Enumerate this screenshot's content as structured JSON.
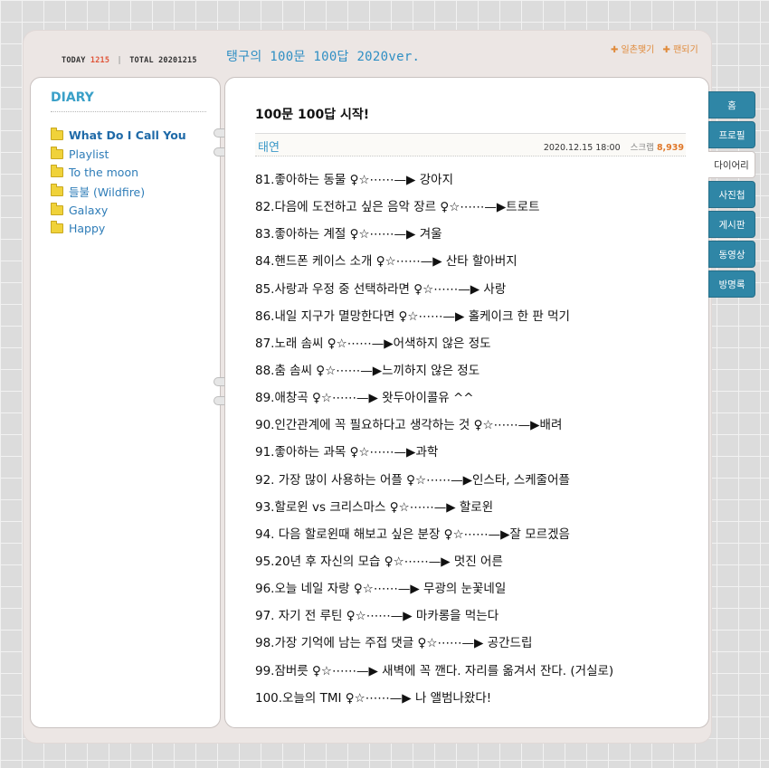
{
  "header": {
    "today_label": "TODAY",
    "today_count": "1215",
    "separator": "|",
    "total_label": "TOTAL",
    "total_count": "20201215",
    "title": "탱구의 100문 100답 2020ver.",
    "link_wave": "✚ 일촌맺기",
    "link_surf": "✚ 팬되기"
  },
  "sidebar": {
    "heading": "DIARY",
    "folders": [
      {
        "label": "What Do I Call You"
      },
      {
        "label": "Playlist"
      },
      {
        "label": "To the moon"
      },
      {
        "label": "들불 (Wildfire)"
      },
      {
        "label": "Galaxy"
      },
      {
        "label": "Happy"
      }
    ]
  },
  "post": {
    "title": "100문 100답 시작!",
    "author": "태연",
    "date": "2020.12.15 18:00",
    "scrap_label": "스크랩",
    "scrap_count": "8,939",
    "lines": [
      "81.좋아하는 동물 ♀☆⋯⋯—▶ 강아지",
      "82.다음에 도전하고 싶은 음악 장르 ♀☆⋯⋯—▶트로트",
      "83.좋아하는 계절 ♀☆⋯⋯—▶ 겨울",
      "84.핸드폰 케이스 소개 ♀☆⋯⋯—▶ 산타 할아버지",
      "85.사랑과 우정 중 선택하라면 ♀☆⋯⋯—▶ 사랑",
      "86.내일 지구가 멸망한다면 ♀☆⋯⋯—▶ 홀케이크 한 판 먹기",
      "87.노래 솜씨 ♀☆⋯⋯—▶어색하지 않은 정도",
      "88.춤 솜씨 ♀☆⋯⋯—▶느끼하지 않은 정도",
      "89.애창곡 ♀☆⋯⋯—▶ 왓두아이콜유 ^^",
      "90.인간관계에 꼭 필요하다고 생각하는 것 ♀☆⋯⋯—▶배려",
      "91.좋아하는 과목 ♀☆⋯⋯—▶과학",
      "92. 가장 많이 사용하는 어플 ♀☆⋯⋯—▶인스타, 스케줄어플",
      "93.할로윈 vs 크리스마스 ♀☆⋯⋯—▶ 할로윈",
      "94. 다음 할로윈때 해보고 싶은 분장 ♀☆⋯⋯—▶잘 모르겠음",
      "95.20년 후 자신의 모습 ♀☆⋯⋯—▶ 멋진 어른",
      "96.오늘 네일 자랑 ♀☆⋯⋯—▶ 무광의 눈꽃네일",
      "97. 자기 전 루틴 ♀☆⋯⋯—▶ 마카롱을 먹는다",
      "98.가장 기억에 남는 주접 댓글 ♀☆⋯⋯—▶ 공간드립",
      "99.잠버릇 ♀☆⋯⋯—▶ 새벽에 꼭 깬다. 자리를 옮겨서 잔다. (거실로)",
      "100.오늘의 TMI ♀☆⋯⋯—▶ 나 앨범나왔다!"
    ]
  },
  "tabs": [
    {
      "label": "홈"
    },
    {
      "label": "프로필"
    },
    {
      "label": "다이어리",
      "active": true
    },
    {
      "label": "사진첩"
    },
    {
      "label": "게시판"
    },
    {
      "label": "동영상"
    },
    {
      "label": "방명록"
    }
  ]
}
